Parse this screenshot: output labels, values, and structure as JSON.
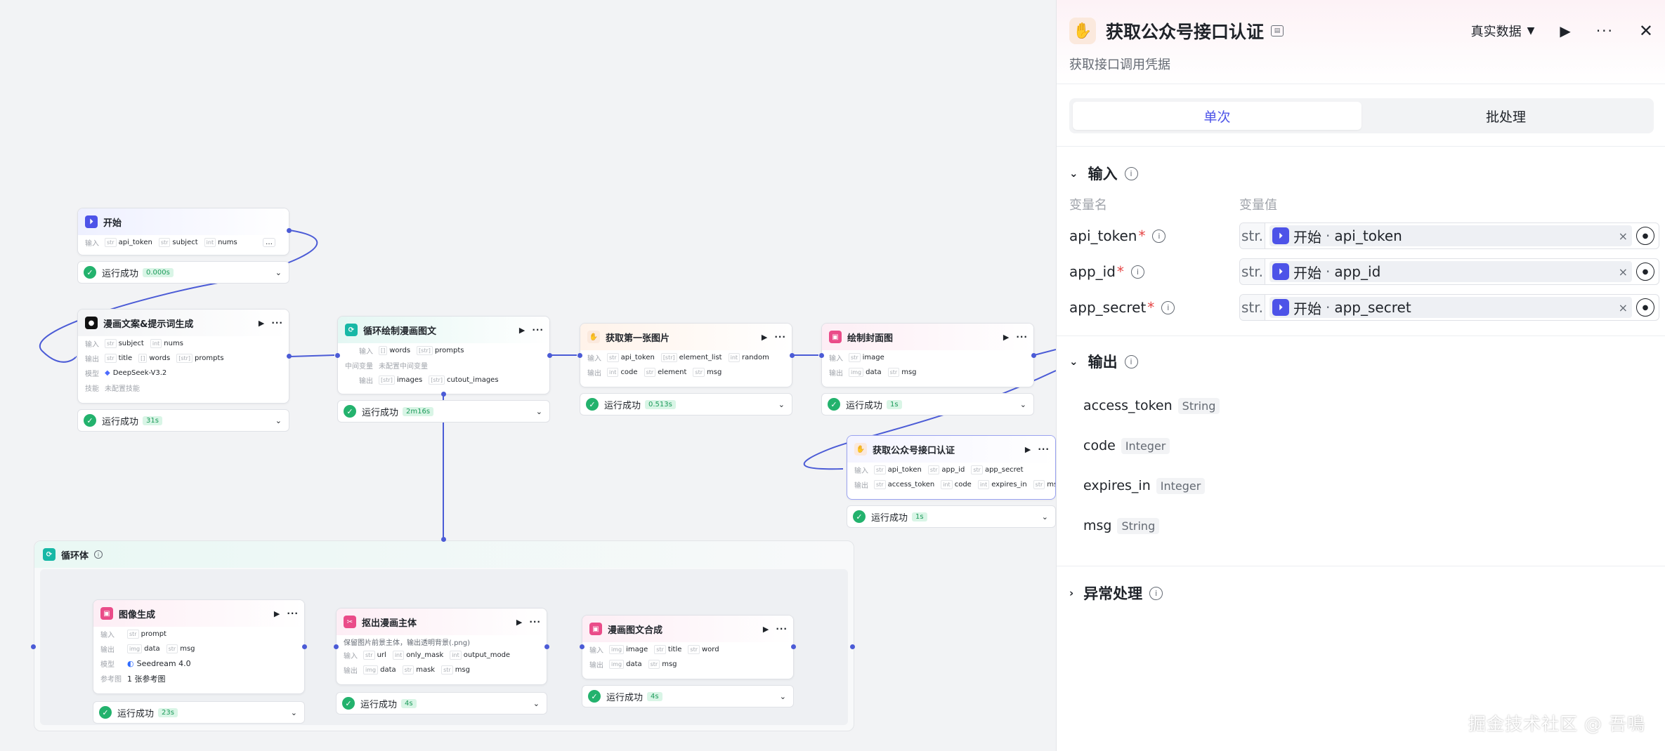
{
  "canvas": {
    "start_node": {
      "title": "开始",
      "input_label": "输入",
      "inputs": [
        {
          "type": "str",
          "name": "api_token"
        },
        {
          "type": "str",
          "name": "subject"
        },
        {
          "type": "int",
          "name": "nums"
        }
      ],
      "more": "…",
      "status": "运行成功",
      "duration": "0.000s"
    },
    "comic_node": {
      "title": "漫画文案&提示词生成",
      "input_label": "输入",
      "output_label": "输出",
      "model_label": "模型",
      "skill_label": "技能",
      "inputs": [
        {
          "type": "str",
          "name": "subject"
        },
        {
          "type": "int",
          "name": "nums"
        }
      ],
      "outputs": [
        {
          "type": "str",
          "name": "title"
        },
        {
          "type": "[]",
          "name": "words"
        },
        {
          "type": "[str]",
          "name": "prompts"
        }
      ],
      "model": "DeepSeek-V3.2",
      "skill": "未配置技能",
      "status": "运行成功",
      "duration": "31s"
    },
    "loop_node": {
      "title": "循环绘制漫画图文",
      "input_label": "输入",
      "mid_label": "中间变量",
      "output_label": "输出",
      "inputs": [
        {
          "type": "[]",
          "name": "words"
        },
        {
          "type": "[str]",
          "name": "prompts"
        }
      ],
      "mid": "未配置中间变量",
      "outputs": [
        {
          "type": "[str]",
          "name": "images"
        },
        {
          "type": "[str]",
          "name": "cutout_images"
        }
      ],
      "status": "运行成功",
      "duration": "2m16s"
    },
    "first_img_node": {
      "title": "获取第一张图片",
      "input_label": "输入",
      "output_label": "输出",
      "inputs": [
        {
          "type": "str",
          "name": "api_token"
        },
        {
          "type": "[str]",
          "name": "element_list"
        },
        {
          "type": "int",
          "name": "random"
        }
      ],
      "outputs": [
        {
          "type": "int",
          "name": "code"
        },
        {
          "type": "str",
          "name": "element"
        },
        {
          "type": "str",
          "name": "msg"
        }
      ],
      "status": "运行成功",
      "duration": "0.513s"
    },
    "cover_node": {
      "title": "绘制封面图",
      "input_label": "输入",
      "output_label": "输出",
      "inputs": [
        {
          "type": "str",
          "name": "image"
        }
      ],
      "outputs": [
        {
          "type": "img",
          "name": "data"
        },
        {
          "type": "str",
          "name": "msg"
        }
      ],
      "status": "运行成功",
      "duration": "1s"
    },
    "auth_node": {
      "title": "获取公众号接口认证",
      "input_label": "输入",
      "output_label": "输出",
      "inputs": [
        {
          "type": "str",
          "name": "api_token"
        },
        {
          "type": "str",
          "name": "app_id"
        },
        {
          "type": "str",
          "name": "app_secret"
        }
      ],
      "outputs": [
        {
          "type": "str",
          "name": "access_token"
        },
        {
          "type": "int",
          "name": "code"
        },
        {
          "type": "int",
          "name": "expires_in"
        },
        {
          "type": "str",
          "name": "msg"
        }
      ],
      "status": "运行成功",
      "duration": "1s"
    },
    "loop_body": {
      "title": "循环体"
    },
    "imggen_node": {
      "title": "图像生成",
      "input_label": "输入",
      "output_label": "输出",
      "model_label": "模型",
      "ref_label": "参考图",
      "inputs": [
        {
          "type": "str",
          "name": "prompt"
        }
      ],
      "outputs": [
        {
          "type": "img",
          "name": "data"
        },
        {
          "type": "str",
          "name": "msg"
        }
      ],
      "model": "Seedream 4.0",
      "ref": "1 张参考图",
      "status": "运行成功",
      "duration": "23s"
    },
    "cutout_node": {
      "title": "抠出漫画主体",
      "desc": "保留图片前景主体，输出透明背景(.png)",
      "input_label": "输入",
      "output_label": "输出",
      "inputs": [
        {
          "type": "str",
          "name": "url"
        },
        {
          "type": "int",
          "name": "only_mask"
        },
        {
          "type": "int",
          "name": "output_mode"
        }
      ],
      "outputs": [
        {
          "type": "img",
          "name": "data"
        },
        {
          "type": "str",
          "name": "mask"
        },
        {
          "type": "str",
          "name": "msg"
        }
      ],
      "status": "运行成功",
      "duration": "4s"
    },
    "compose_node": {
      "title": "漫画图文合成",
      "input_label": "输入",
      "output_label": "输出",
      "inputs": [
        {
          "type": "img",
          "name": "image"
        },
        {
          "type": "str",
          "name": "title"
        },
        {
          "type": "str",
          "name": "word"
        }
      ],
      "outputs": [
        {
          "type": "img",
          "name": "data"
        },
        {
          "type": "str",
          "name": "msg"
        }
      ],
      "status": "运行成功",
      "duration": "4s"
    }
  },
  "panel": {
    "title": "获取公众号接口认证",
    "subtitle": "获取接口调用凭据",
    "data_mode": "真实数据",
    "tabs": [
      "单次",
      "批处理"
    ],
    "active_tab": 0,
    "input_section": "输入",
    "col_name": "变量名",
    "col_value": "变量值",
    "inputs": [
      {
        "name": "api_token",
        "type": "str.",
        "source": "开始",
        "var": "api_token"
      },
      {
        "name": "app_id",
        "type": "str.",
        "source": "开始",
        "var": "app_id"
      },
      {
        "name": "app_secret",
        "type": "str.",
        "source": "开始",
        "var": "app_secret"
      }
    ],
    "output_section": "输出",
    "outputs": [
      {
        "name": "access_token",
        "type": "String"
      },
      {
        "name": "code",
        "type": "Integer"
      },
      {
        "name": "expires_in",
        "type": "Integer"
      },
      {
        "name": "msg",
        "type": "String"
      }
    ],
    "error_section": "异常处理"
  },
  "watermark": "掘金技术社区 @ 吾鳴",
  "colors": {
    "accent": "#4d53e8",
    "success": "#23b26d",
    "edge": "#4b5bd6"
  }
}
